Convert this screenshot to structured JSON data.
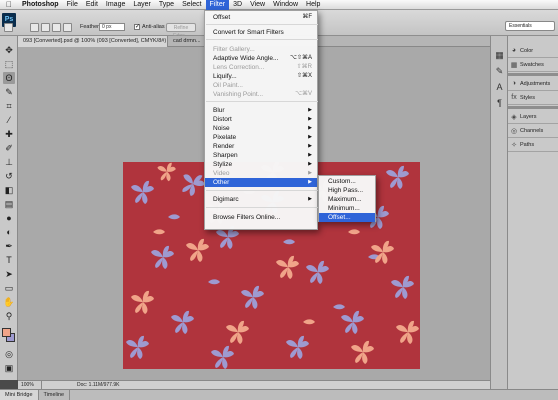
{
  "menubar": {
    "app": "Photoshop",
    "items": [
      "File",
      "Edit",
      "Image",
      "Layer",
      "Type",
      "Select",
      "Filter",
      "3D",
      "View",
      "Window",
      "Help"
    ],
    "active": "Filter"
  },
  "options": {
    "logo": "Ps",
    "feather_label": "Feather:",
    "feather_value": "0 px",
    "antialias_label": "Anti-alias",
    "refine_label": "Refine Edge...",
    "workspace": "Essentials"
  },
  "tabs": [
    {
      "label": "093 [Converted].psd @ 100% (093 [Converted], CMYK/8#)",
      "active": true
    },
    {
      "label": "cad drmn...",
      "active": false
    }
  ],
  "filter_menu": {
    "items": [
      {
        "label": "Offset",
        "shortcut": "⌘F",
        "disabled": false,
        "arrow": false
      },
      {
        "sep": true
      },
      {
        "label": "Convert for Smart Filters",
        "disabled": false
      },
      {
        "sep": true
      },
      {
        "label": "Filter Gallery...",
        "disabled": true
      },
      {
        "label": "Adaptive Wide Angle...",
        "shortcut": "⌥⇧⌘A",
        "disabled": false
      },
      {
        "label": "Lens Correction...",
        "shortcut": "⇧⌘R",
        "disabled": true
      },
      {
        "label": "Liquify...",
        "shortcut": "⇧⌘X",
        "disabled": false
      },
      {
        "label": "Oil Paint...",
        "disabled": true
      },
      {
        "label": "Vanishing Point...",
        "shortcut": "⌥⌘V",
        "disabled": true
      },
      {
        "sep": true
      },
      {
        "label": "Blur",
        "arrow": true
      },
      {
        "label": "Distort",
        "arrow": true
      },
      {
        "label": "Noise",
        "arrow": true
      },
      {
        "label": "Pixelate",
        "arrow": true
      },
      {
        "label": "Render",
        "arrow": true
      },
      {
        "label": "Sharpen",
        "arrow": true
      },
      {
        "label": "Stylize",
        "arrow": true
      },
      {
        "label": "Video",
        "arrow": true,
        "disabled": true
      },
      {
        "label": "Other",
        "arrow": true,
        "highlighted": true
      },
      {
        "sep": true
      },
      {
        "label": "Digimarc",
        "arrow": true
      },
      {
        "sep": true
      },
      {
        "label": "Browse Filters Online..."
      }
    ]
  },
  "other_submenu": {
    "items": [
      {
        "label": "Custom...",
        "highlighted": false
      },
      {
        "label": "High Pass...",
        "highlighted": false
      },
      {
        "label": "Maximum...",
        "highlighted": false
      },
      {
        "label": "Minimum...",
        "highlighted": false
      },
      {
        "label": "Offset...",
        "highlighted": true
      }
    ]
  },
  "status": {
    "zoom": "100%",
    "doc": "Doc: 1.11M/977.9K"
  },
  "bottom_tabs": [
    "Mini Bridge",
    "Timeline"
  ],
  "panels": [
    {
      "label": "Color",
      "icon": "color-icon"
    },
    {
      "label": "Swatches",
      "icon": "swatches-icon"
    },
    {
      "label": "Adjustments",
      "icon": "adjustments-icon"
    },
    {
      "label": "Styles",
      "icon": "styles-icon"
    },
    {
      "label": "Layers",
      "icon": "layers-icon"
    },
    {
      "label": "Channels",
      "icon": "channels-icon"
    },
    {
      "label": "Paths",
      "icon": "paths-icon"
    }
  ],
  "colors": {
    "foreground": "#f0a489",
    "background": "#9e9ad0",
    "canvas": "#b0343d",
    "highlight": "#2f64d8"
  }
}
